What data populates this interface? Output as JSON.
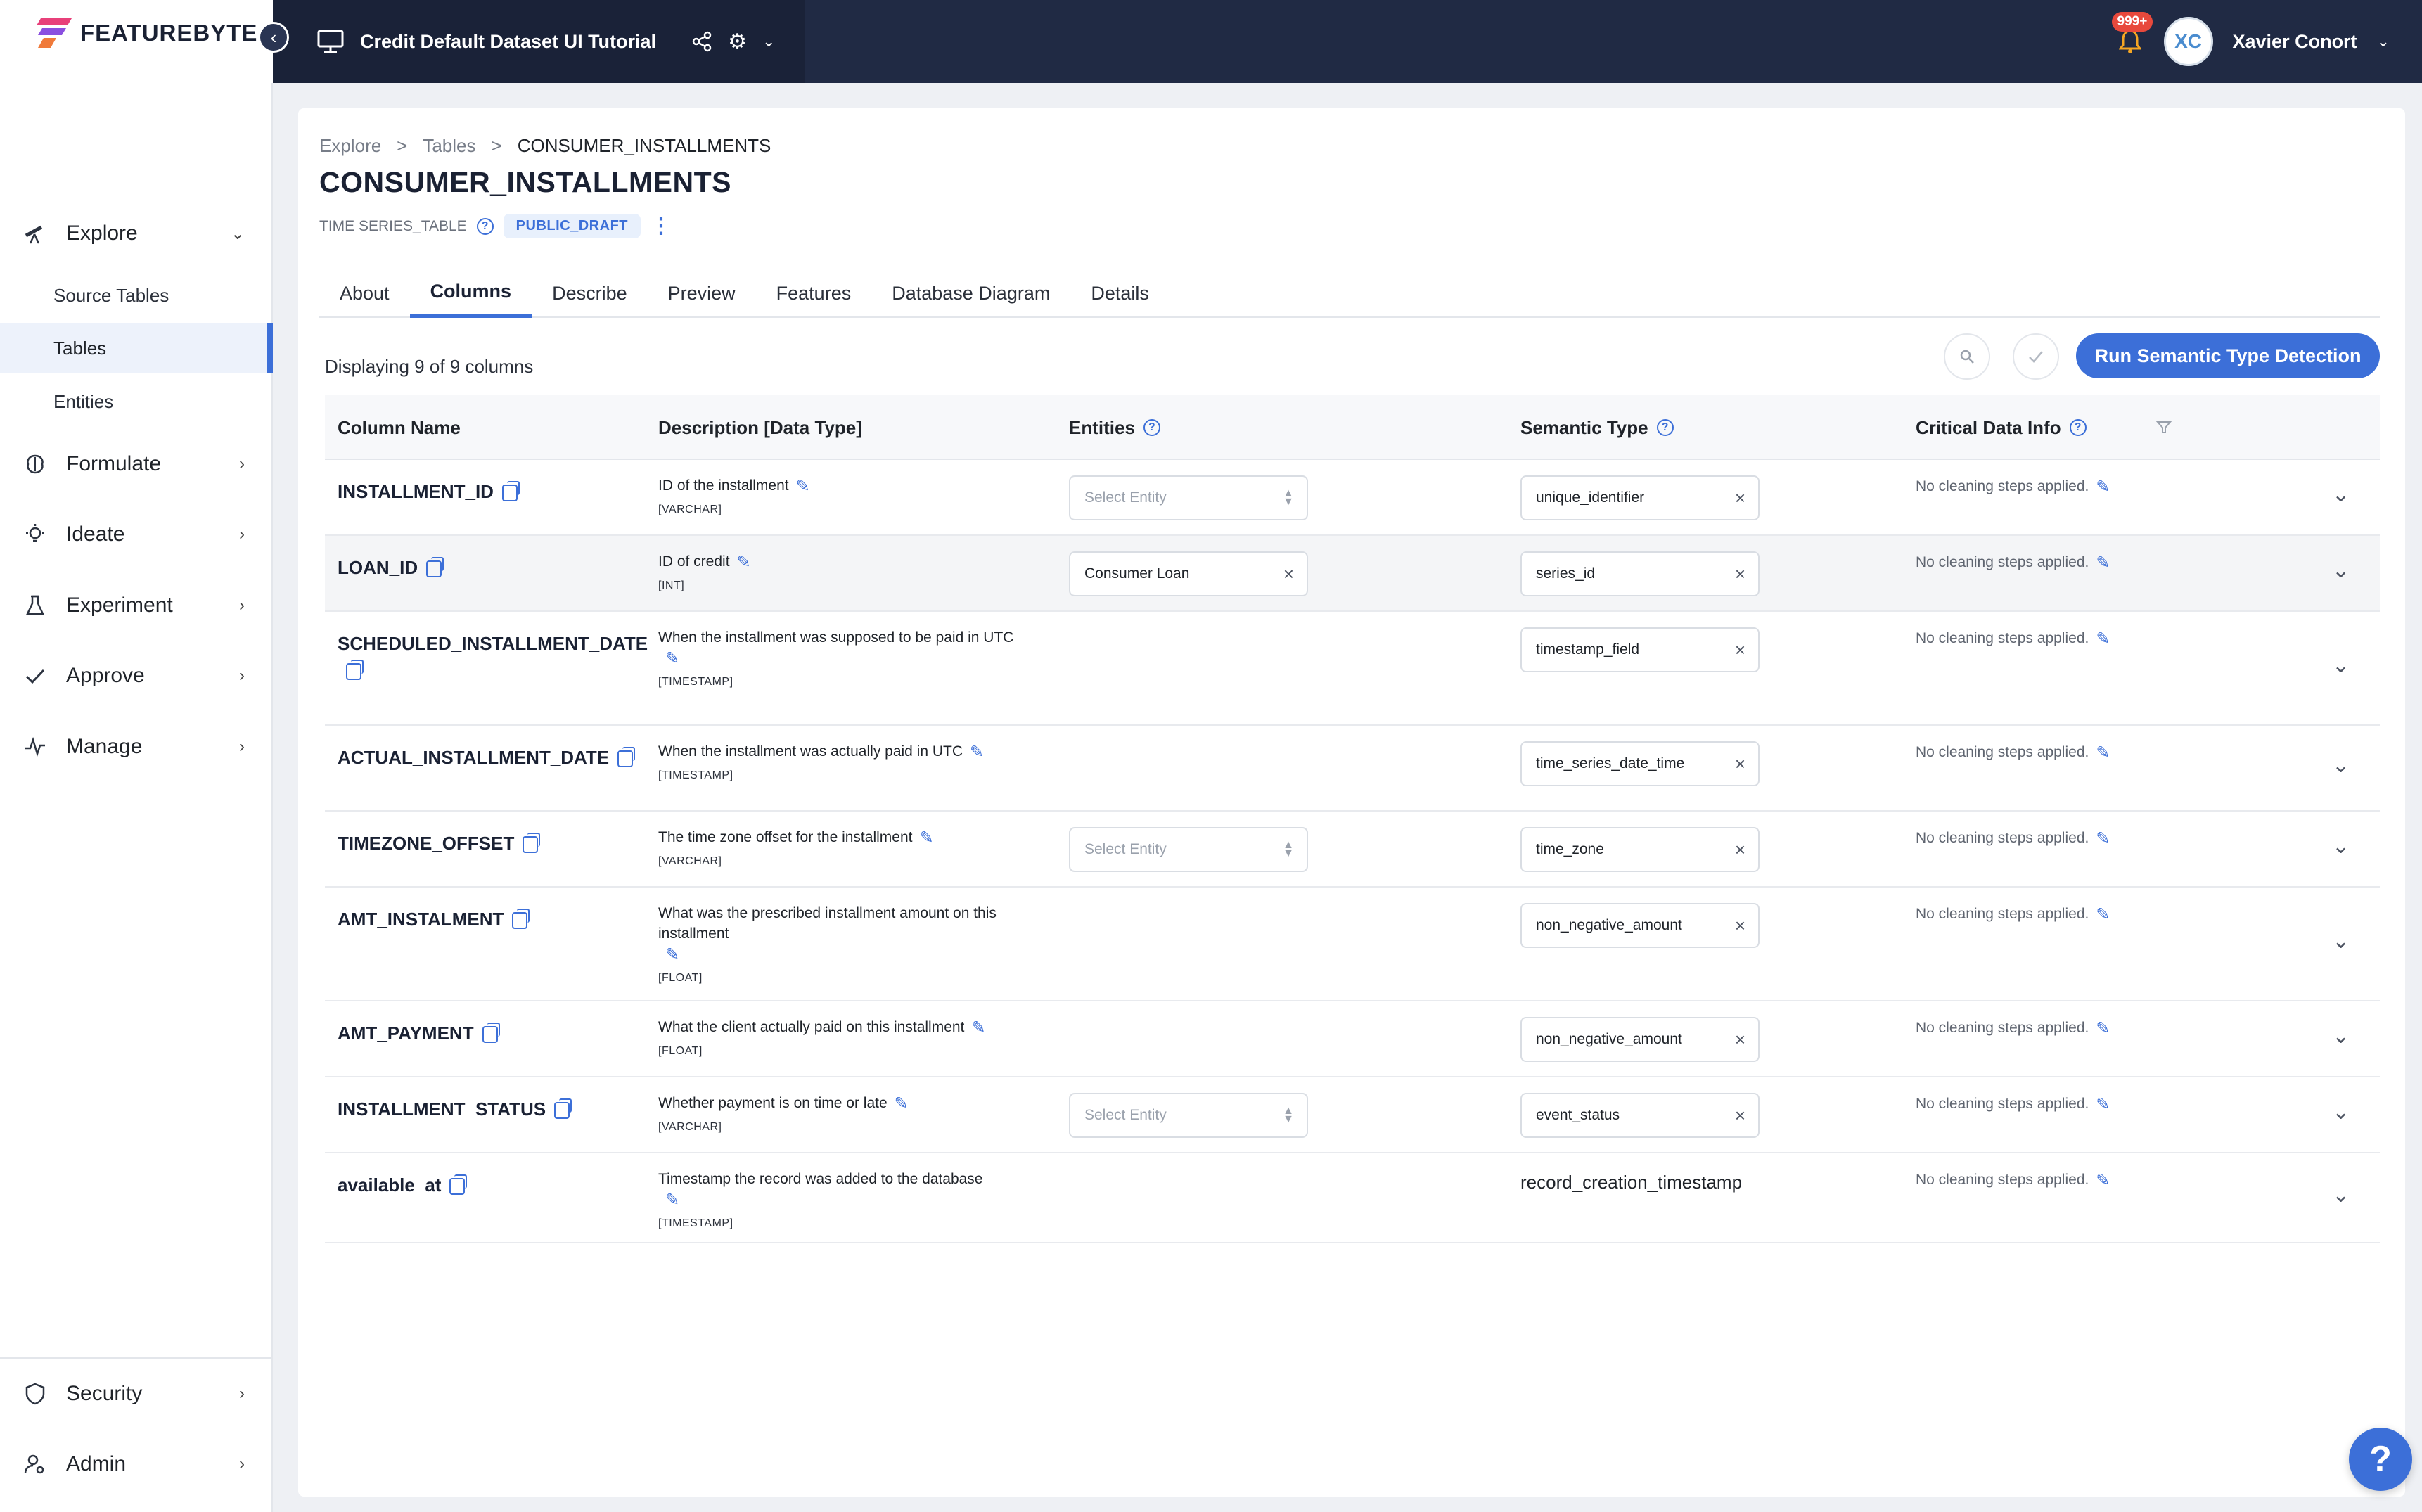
{
  "app": {
    "logo_text": "FEATUREBYTE",
    "project_title": "Credit Default Dataset UI Tutorial",
    "notifications_count": "999+",
    "user_initials": "XC",
    "user_name": "Xavier Conort"
  },
  "sidebar": {
    "explore": "Explore",
    "explore_items": [
      "Source Tables",
      "Tables",
      "Entities"
    ],
    "formulate": "Formulate",
    "ideate": "Ideate",
    "experiment": "Experiment",
    "approve": "Approve",
    "manage": "Manage",
    "security": "Security",
    "admin": "Admin"
  },
  "breadcrumb": [
    "Explore",
    "Tables",
    "CONSUMER_INSTALLMENTS"
  ],
  "page": {
    "title": "CONSUMER_INSTALLMENTS",
    "table_type": "TIME SERIES_TABLE",
    "status": "PUBLIC_DRAFT",
    "displaying": "Displaying 9 of 9 columns",
    "run_button": "Run Semantic Type Detection"
  },
  "tabs": [
    "About",
    "Columns",
    "Describe",
    "Preview",
    "Features",
    "Database Diagram",
    "Details"
  ],
  "active_tab": "Columns",
  "table": {
    "headers": {
      "column_name": "Column Name",
      "description": "Description [Data Type]",
      "entities": "Entities",
      "semantic_type": "Semantic Type",
      "critical": "Critical Data Info"
    },
    "entity_placeholder": "Select Entity",
    "cleaning_text": "No cleaning steps applied.",
    "rows": [
      {
        "name": "INSTALLMENT_ID",
        "desc": "ID of the installment",
        "dtype": "[VARCHAR]",
        "entity": "",
        "semantic": "unique_identifier"
      },
      {
        "name": "LOAN_ID",
        "desc": "ID of credit",
        "dtype": "[INT]",
        "entity": "Consumer Loan",
        "semantic": "series_id"
      },
      {
        "name": "SCHEDULED_INSTALLMENT_DATE",
        "desc": "When the installment was supposed to be paid in UTC",
        "dtype": "[TIMESTAMP]",
        "entity": "",
        "semantic": "timestamp_field"
      },
      {
        "name": "ACTUAL_INSTALLMENT_DATE",
        "desc": "When the installment was actually paid in UTC",
        "dtype": "[TIMESTAMP]",
        "entity": "",
        "semantic": "time_series_date_time"
      },
      {
        "name": "TIMEZONE_OFFSET",
        "desc": "The time zone offset for the installment",
        "dtype": "[VARCHAR]",
        "entity": "",
        "semantic": "time_zone"
      },
      {
        "name": "AMT_INSTALMENT",
        "desc": "What was the prescribed installment amount on this installment",
        "dtype": "[FLOAT]",
        "entity": "",
        "semantic": "non_negative_amount"
      },
      {
        "name": "AMT_PAYMENT",
        "desc": "What the client actually paid on this installment",
        "dtype": "[FLOAT]",
        "entity": "",
        "semantic": "non_negative_amount"
      },
      {
        "name": "INSTALLMENT_STATUS",
        "desc": "Whether payment is on time or late",
        "dtype": "[VARCHAR]",
        "entity": "",
        "semantic": "event_status"
      },
      {
        "name": "available_at",
        "desc": "Timestamp the record was added to the database",
        "dtype": "[TIMESTAMP]",
        "entity": "",
        "semantic": "record_creation_timestamp"
      }
    ]
  },
  "help_fab": "?"
}
